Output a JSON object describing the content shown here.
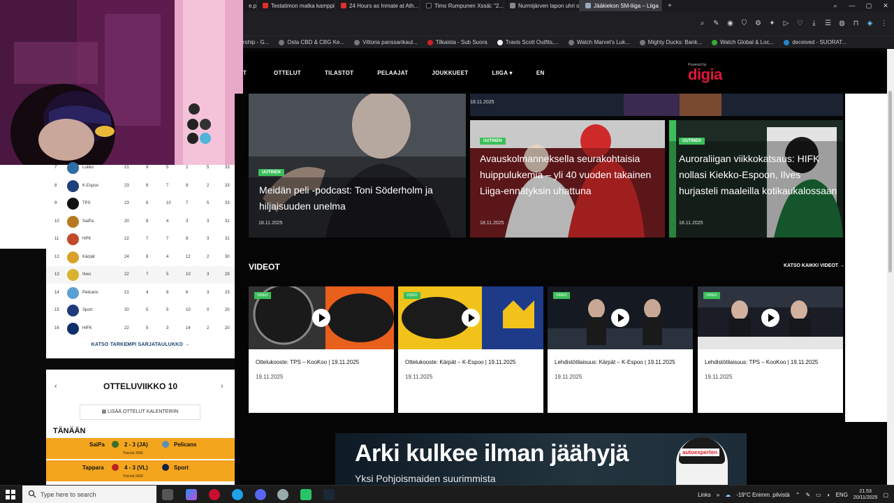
{
  "browser": {
    "tabs": [
      {
        "label": "Testatimon matka kamppi...",
        "icon": "youtube-icon"
      },
      {
        "label": "24 Hours as Inmate at Ath...",
        "icon": "youtube-icon"
      },
      {
        "label": "Timo Rumpunen Xssäi: \"2...",
        "icon": "x-icon"
      },
      {
        "label": "Nurmijärven tapon uhri o...",
        "icon": "news-icon"
      },
      {
        "label": "Jääkiekon SM-liiga – Liiga",
        "icon": "liiga-icon",
        "active": true
      }
    ],
    "new_tab": "+",
    "bookmarks": [
      "rship - G...",
      "Osta CBD & CBG Ke...",
      "Vittoria panssarikaul...",
      "Tilkaista - Sub Suora",
      "Travis Scott Outfits,...",
      "Watch Marvel's Luk...",
      "Mighty Ducks: Bank...",
      "Watch Global & Loc...",
      "deceived - SUORAT..."
    ]
  },
  "site": {
    "nav_partial": "T",
    "nav": [
      "OTTELUT",
      "TILASTOT",
      "PELAAJAT",
      "JOUKKUEET",
      "LIIGA ▾",
      "EN"
    ],
    "powered_by": "Powered by",
    "sponsor": "digia"
  },
  "news": {
    "top_strip_date": "18.11.2025",
    "cards": [
      {
        "badge": "UUTINEN",
        "title": "Meidän peli -podcast: Toni Söderholm ja hiljaisuuden unelma",
        "date": "18.11.2025"
      },
      {
        "badge": "UUTINEN",
        "title": "Avauskolmanneksella seurakohtaisia huippulukemia – yli 40 vuoden takainen Liiga-ennätyksin uhattuna",
        "date": "18.11.2025"
      },
      {
        "badge": "UUTINEN",
        "title": "Auroraliigan viikkokatsaus: HIFK nollasi Kiekko-Espoon, Ilves hurjasteli maaleilla kotikaukalossaan",
        "date": "18.11.2025"
      }
    ]
  },
  "videos": {
    "heading": "VIDEOT",
    "see_all": "KATSO KAIKKI VIDEOT →",
    "items": [
      {
        "badge": "VIDEO",
        "title": "Ottelukooste: TPS – KooKoo | 19.11.2025",
        "date": "19.11.2025"
      },
      {
        "badge": "VIDEO",
        "title": "Ottelukooste: Kärpät – K-Espoo | 19.11.2025",
        "date": "19.11.2025"
      },
      {
        "badge": "VIDEO",
        "title": "Lehdistötilaisuus: Kärpät – K-Espoo | 19.11.2025",
        "date": "19.11.2025"
      },
      {
        "badge": "VIDEO",
        "title": "Lehdistötilaisuus: TPS – KooKoo | 19.11.2025",
        "date": "19.11.2025"
      }
    ]
  },
  "standings": {
    "rows": [
      {
        "pos": "7",
        "team": "Lukko",
        "gp": "21",
        "w": "9",
        "otw": "5",
        "otl": "2",
        "l": "5",
        "pts": "33"
      },
      {
        "pos": "8",
        "team": "K-Espoo",
        "gp": "23",
        "w": "8",
        "otw": "7",
        "otl": "8",
        "l": "2",
        "pts": "33"
      },
      {
        "pos": "9",
        "team": "TPS",
        "gp": "23",
        "w": "6",
        "otw": "10",
        "otl": "7",
        "l": "5",
        "pts": "33"
      },
      {
        "pos": "10",
        "team": "SaiPa",
        "gp": "20",
        "w": "8",
        "otw": "4",
        "otl": "3",
        "l": "3",
        "pts": "31"
      },
      {
        "pos": "11",
        "team": "HPK",
        "gp": "22",
        "w": "7",
        "otw": "7",
        "otl": "8",
        "l": "3",
        "pts": "31"
      },
      {
        "pos": "12",
        "team": "Kärpät",
        "gp": "24",
        "w": "8",
        "otw": "4",
        "otl": "12",
        "l": "2",
        "pts": "30"
      },
      {
        "pos": "13",
        "team": "Ilves",
        "gp": "22",
        "w": "7",
        "otw": "5",
        "otl": "10",
        "l": "3",
        "pts": "29"
      },
      {
        "pos": "14",
        "team": "Pelicans",
        "gp": "21",
        "w": "4",
        "otw": "8",
        "otl": "6",
        "l": "3",
        "pts": "23"
      },
      {
        "pos": "15",
        "team": "Sport",
        "gp": "20",
        "w": "5",
        "otw": "5",
        "otl": "10",
        "l": "0",
        "pts": "20"
      },
      {
        "pos": "16",
        "team": "HIFK",
        "gp": "22",
        "w": "5",
        "otw": "3",
        "otl": "14",
        "l": "2",
        "pts": "20"
      }
    ],
    "more_link": "KATSO TARKEMPI SARJATAULUKKO →"
  },
  "week": {
    "title": "OTTELUVIIKKO 10",
    "calendar_btn": "LISÄÄ OTTELUT KALENTERIIN",
    "today": "TÄNÄÄN",
    "matches": [
      {
        "home": "SaiPa",
        "score": "2 - 3 (JA)",
        "away": "Pelicans",
        "audience": "Yleisöä 3566"
      },
      {
        "home": "Tappara",
        "score": "4 - 3 (VL)",
        "away": "Sport",
        "audience": "Yleisöä 5506"
      }
    ]
  },
  "ad": {
    "headline": "Arki kulkee ilman jäähyjä",
    "sub": "Yksi Pohjoismaiden suurimmista",
    "brand": "autoexperten"
  },
  "taskbar": {
    "search_placeholder": "Type here to search",
    "links": "Links",
    "weather": "-19°C  Enimm. pilvistä",
    "lang": "ENG",
    "time": "21.53",
    "date": "20/11/2025"
  },
  "colors": {
    "accent_green": "#3cbf5a",
    "match_orange": "#f3a51d",
    "digia_red": "#e3153b"
  }
}
